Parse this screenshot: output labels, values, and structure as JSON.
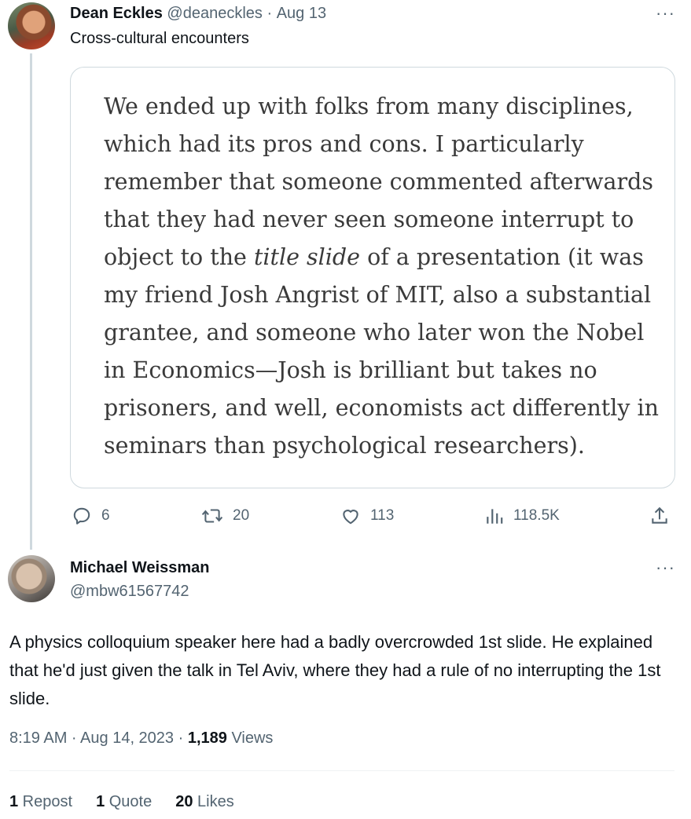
{
  "tweet1": {
    "author_name": "Dean Eckles",
    "handle": "@deaneckles",
    "separator": "·",
    "date": "Aug 13",
    "text": "Cross-cultural encounters",
    "quote": {
      "lines_before_italic": "We ended up with folks from many disciplines, which had its pros and cons. I particularly remember that someone commented afterwards that they had never seen someone interrupt to object to the ",
      "italic": "title slide",
      "lines_after_italic": " of a presentation (it was my friend Josh Angrist of MIT, also a substantial grantee, and someone who later won the Nobel in Economics—Josh is brilliant but takes no prisoners, and well, economists act differently in seminars than psychological researchers)."
    },
    "actions": {
      "replies": "6",
      "reposts": "20",
      "likes": "113",
      "views": "118.5K"
    },
    "more_label": "···"
  },
  "tweet2": {
    "author_name": "Michael Weissman",
    "handle": "@mbw61567742",
    "more_label": "···",
    "text": "A physics colloquium speaker here had a badly overcrowded 1st slide. He explained that he'd just given the talk in Tel Aviv, where they had a rule of no interrupting the 1st slide.",
    "time": "8:19 AM · Aug 14, 2023 · ",
    "views_count": "1,189",
    "views_label": " Views",
    "stats": {
      "reposts_count": "1",
      "reposts_label": " Repost",
      "quotes_count": "1",
      "quotes_label": " Quote",
      "likes_count": "20",
      "likes_label": " Likes"
    }
  },
  "icons": [
    "reply-icon",
    "repost-icon",
    "like-icon",
    "views-icon",
    "share-icon",
    "more-icon"
  ],
  "colors": {
    "text": "#0f1419",
    "muted": "#536471",
    "border": "#cfd9de"
  }
}
